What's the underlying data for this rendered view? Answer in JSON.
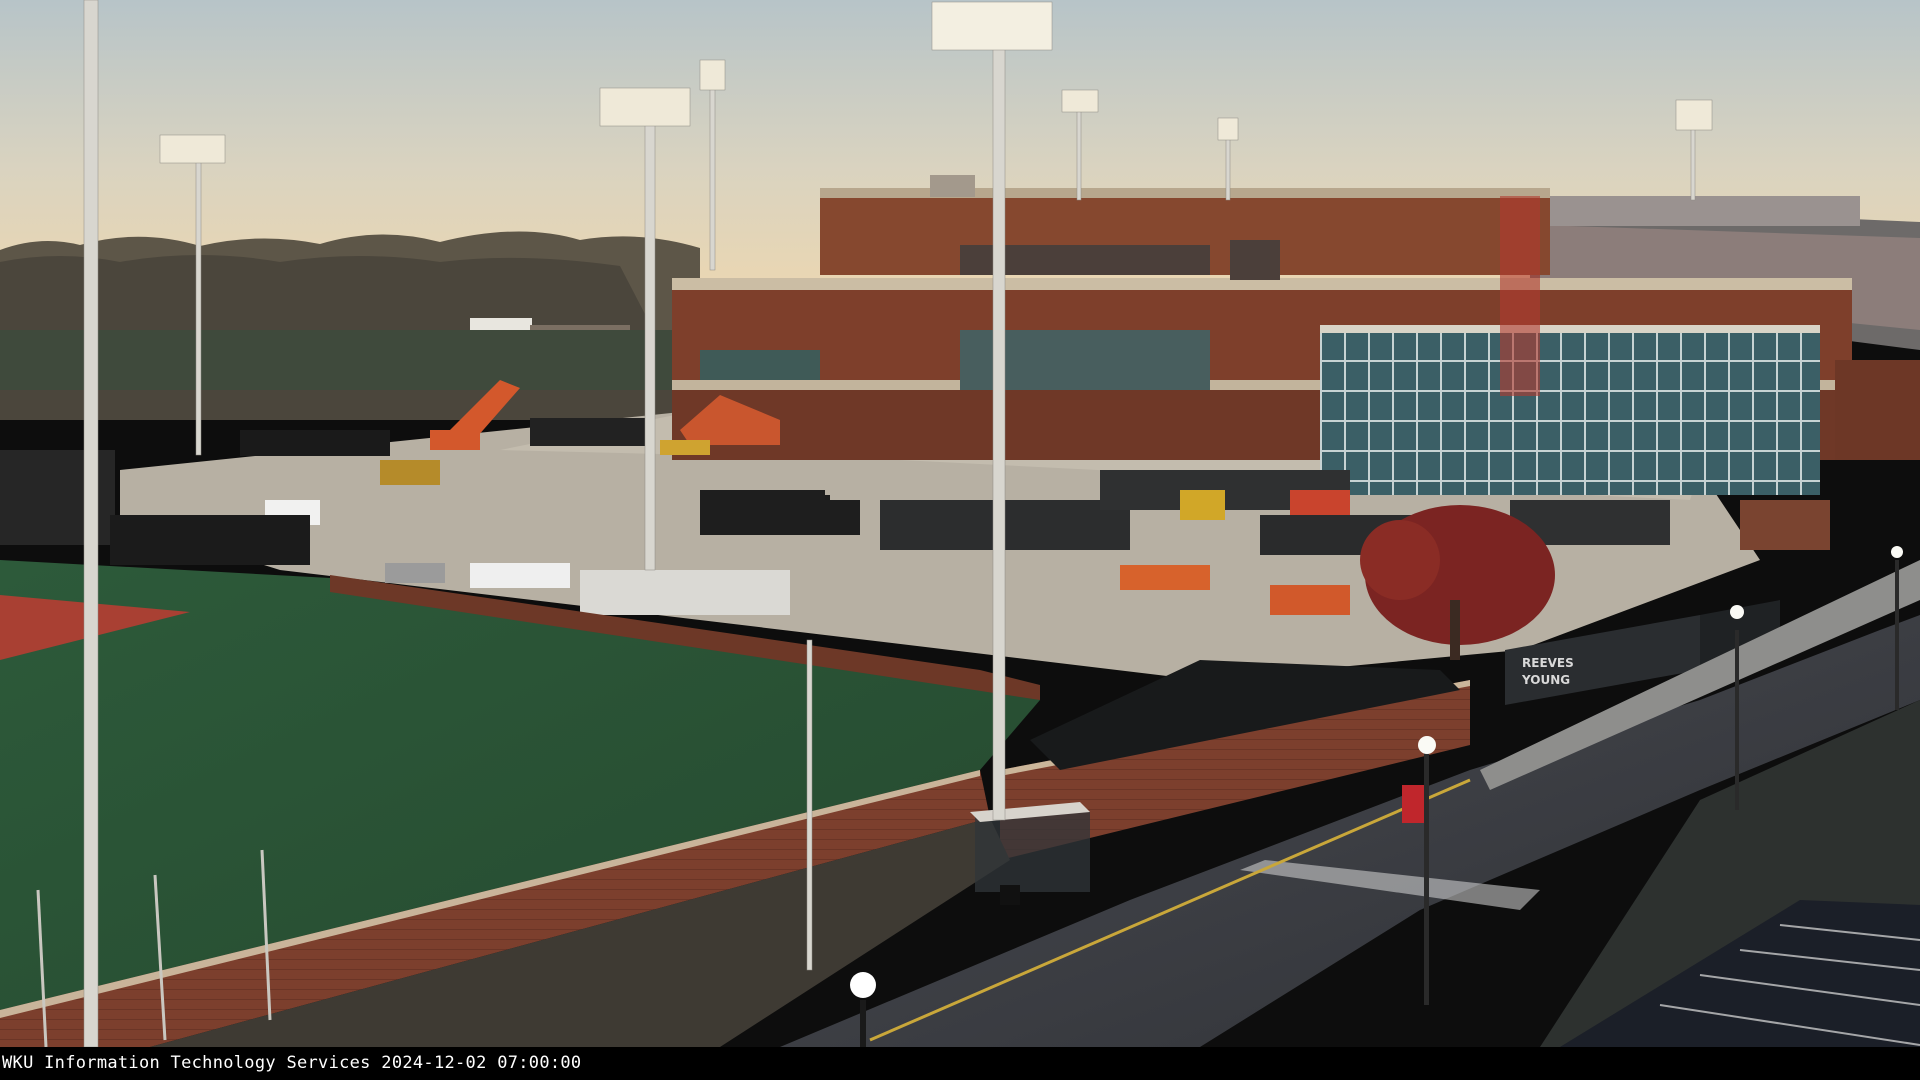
{
  "caption": {
    "source": "WKU Information Technology Services",
    "date": "2024-12-02",
    "time": "07:00:00"
  },
  "signage": {
    "fence_banner_line1": "REEVES",
    "fence_banner_line2": "YOUNG"
  },
  "colors": {
    "sky_top": "#b9c6c9",
    "sky_bottom": "#e9d7b6",
    "turf": "#2f5a3c",
    "brick": "#7a3d2c",
    "asphalt": "#3a3d42"
  }
}
